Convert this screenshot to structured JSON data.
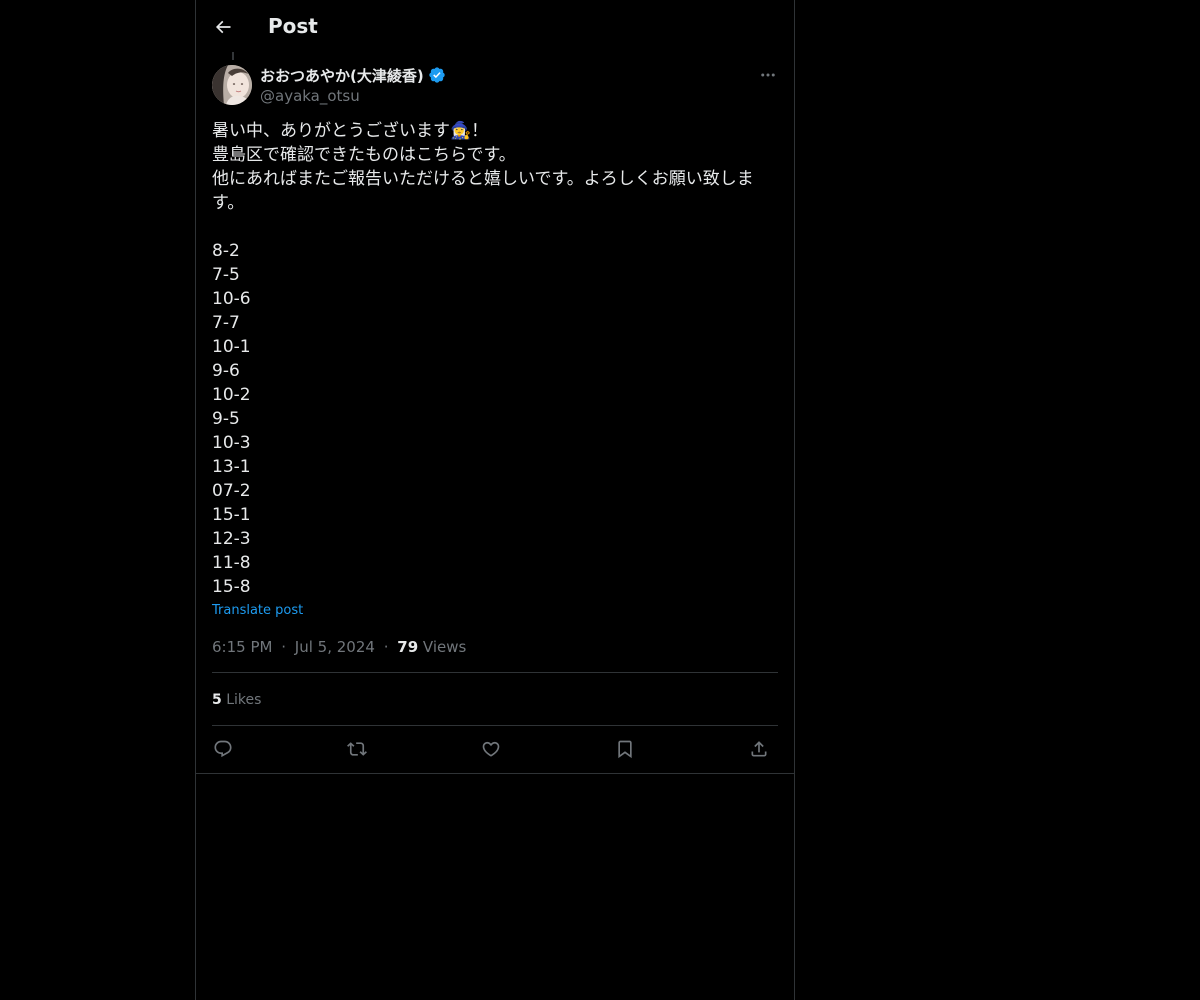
{
  "header": {
    "title": "Post"
  },
  "author": {
    "display_name": "おおつあやか(大津綾香)",
    "handle": "@ayaka_otsu",
    "verified": true
  },
  "tweet": {
    "lines": [
      "暑い中、ありがとうございます🧙‍♀️！",
      "豊島区で確認できたものはこちらです。",
      "他にあればまたご報告いただけると嬉しいです。よろしくお願い致します。",
      "",
      "8-2",
      "7-5",
      "10-6",
      "7-7",
      "10-1",
      "9-6",
      "10-2",
      "9-5",
      "10-3",
      "13-1",
      "07-2",
      "15-1",
      "12-3",
      "11-8",
      "15-8"
    ],
    "translate_label": "Translate post"
  },
  "meta": {
    "time": "6:15 PM",
    "separator": "·",
    "date": "Jul 5, 2024",
    "views_count": "79",
    "views_label": "Views"
  },
  "engagement": {
    "likes_count": "5",
    "likes_label": "Likes"
  },
  "colors": {
    "background": "#000000",
    "text": "#e7e9ea",
    "secondary": "#71767b",
    "accent": "#1d9bf0",
    "border": "#2f3336"
  },
  "icons": {
    "back": "arrow-left-icon",
    "verified": "verified-badge-icon",
    "more": "more-horizontal-icon",
    "reply": "reply-icon",
    "repost": "repost-icon",
    "like": "heart-icon",
    "bookmark": "bookmark-icon",
    "share": "share-icon"
  }
}
